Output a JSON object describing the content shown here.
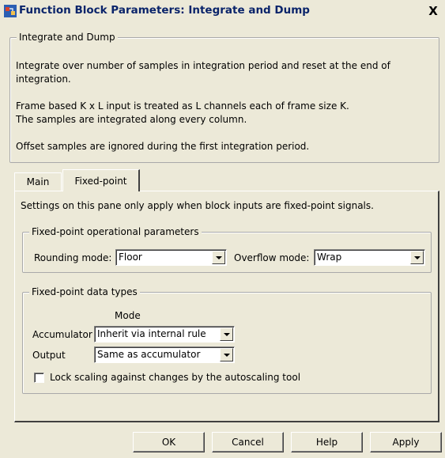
{
  "window": {
    "title": "Function Block Parameters: Integrate and Dump",
    "close_glyph": "X"
  },
  "block": {
    "group_label": "Integrate and Dump",
    "desc1": "Integrate over number of samples in integration period and reset at the end of",
    "desc2": "integration.",
    "desc3": "Frame based K x L input is treated as L channels each of frame size K.",
    "desc4": "The samples are integrated along every column.",
    "desc5": "Offset samples are ignored during the first integration period."
  },
  "tabs": [
    {
      "label": "Main",
      "active": false
    },
    {
      "label": "Fixed-point",
      "active": true
    }
  ],
  "fixed_point": {
    "intro": "Settings on this pane only apply when block inputs are fixed-point signals.",
    "op_params_label": "Fixed-point operational parameters",
    "rounding_label": "Rounding mode:",
    "rounding_value": "Floor",
    "overflow_label": "Overflow mode:",
    "overflow_value": "Wrap",
    "data_types_label": "Fixed-point data types",
    "mode_header": "Mode",
    "accumulator_label": "Accumulator",
    "accumulator_value": "Inherit via internal rule",
    "output_label": "Output",
    "output_value": "Same as accumulator",
    "lock_scaling_label": "Lock scaling against changes by the autoscaling tool",
    "lock_scaling_checked": false
  },
  "buttons": {
    "ok": "OK",
    "cancel": "Cancel",
    "help": "Help",
    "apply": "Apply"
  },
  "colors": {
    "dialog_bg": "#ece9d8",
    "title_text": "#0a246a"
  }
}
